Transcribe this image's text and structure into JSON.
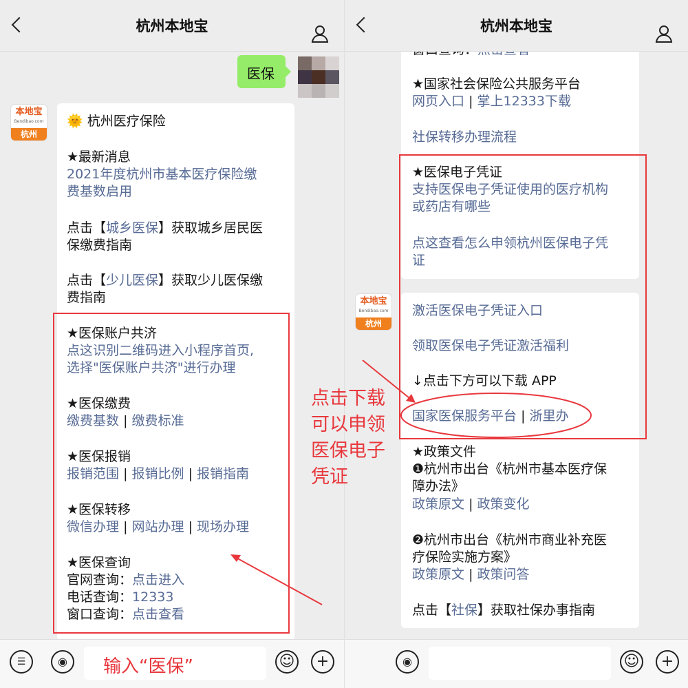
{
  "app_title": "杭州本地宝",
  "logo": {
    "brand": "本地宝",
    "domain": "Bendibao.com",
    "city": "杭州"
  },
  "user_message": "医保",
  "left_card": {
    "title_emoji": "🌞",
    "title": "杭州医疗保险",
    "news_heading": "★最新消息",
    "news_link_l1": "2021年度杭州市基本医疗保险缴",
    "news_link_l2": "费基数启用",
    "p1_pre": "点击【",
    "p1_link": "城乡医保",
    "p1_post": "】获取城乡居民医",
    "p1_l2": "保缴费指南",
    "p2_pre": "点击【",
    "p2_link": "少儿医保",
    "p2_post": "】获取少儿医保缴",
    "p2_l2": "费指南",
    "account_heading": "★医保账户共济",
    "account_l1": "点这识别二维码进入小程序首页,",
    "account_l2": "选择\"医保账户共济\"进行办理",
    "pay_heading": "★医保缴费",
    "pay_link1": "缴费基数",
    "pay_link2": "缴费标准",
    "reimb_heading": "★医保报销",
    "reimb_link1": "报销范围",
    "reimb_link2": "报销比例",
    "reimb_link3": "报销指南",
    "transfer_heading": "★医保转移",
    "transfer_link1": "微信办理",
    "transfer_link2": "网站办理",
    "transfer_link3": "现场办理",
    "query_heading": "★医保查询",
    "q1_label": "官网查询：",
    "q1_link": "点击进入",
    "q2_label": "电话查询：",
    "q2_link": "12333",
    "q3_label": "窗口查询：",
    "q3_link": "点击查看",
    "sep": "|"
  },
  "right_card1": {
    "cut_label": "窗口查询：",
    "cut_link": "点击查看",
    "national_heading": "★国家社会保险公共服务平台",
    "national_link1": "网页入口",
    "national_link2": "掌上12333下载",
    "transfer_flow": "社保转移办理流程",
    "ecert_heading": "★医保电子凭证",
    "ecert_link1_l1": "支持医保电子凭证使用的医疗机构",
    "ecert_link1_l2": "或药店有哪些",
    "ecert_link2_l1": "点这查看怎么申领杭州医保电子凭",
    "ecert_link2_l2": "证"
  },
  "right_card2": {
    "activate": "激活医保电子凭证入口",
    "benefit": "领取医保电子凭证激活福利",
    "download_hint": "↓点击下方可以下载 APP",
    "platform_link": "国家医保服务平台",
    "zheli_link": "浙里办",
    "policy_heading": "★政策文件",
    "policy1_l1": "❶杭州市出台《杭州市基本医疗保",
    "policy1_l2": "障办法》",
    "policy1_link1": "政策原文",
    "policy1_link2": "政策变化",
    "policy2_l1": "❷杭州市出台《杭州市商业补充医",
    "policy2_l2": "疗保险实施方案》",
    "policy2_link1": "政策原文",
    "policy2_link2": "政策问答",
    "social_pre": "点击【",
    "social_link": "社保",
    "social_post": "】获取社保办事指南",
    "sep": "|"
  },
  "annotation": {
    "l1": "点击下载",
    "l2": "可以申领",
    "l3": "医保电子",
    "l4": "凭证"
  },
  "input_hint": "输入“医保”",
  "colors": {
    "link": "#576b95",
    "red": "#e8383d",
    "bubble_green": "#95ec69"
  }
}
